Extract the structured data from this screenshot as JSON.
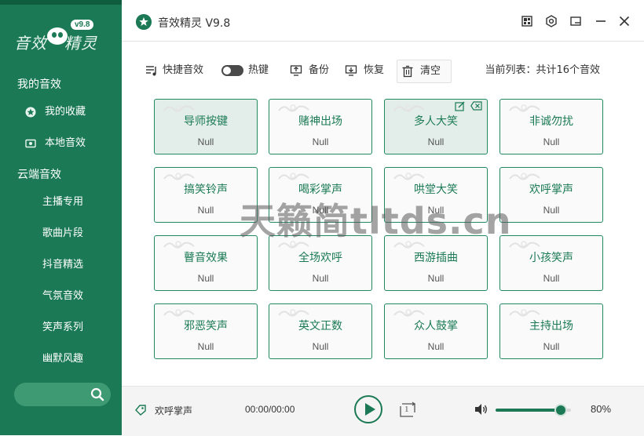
{
  "sidebar": {
    "logo": {
      "text_left": "音效",
      "text_right": "精灵",
      "version": "v9.8"
    },
    "my_sounds_label": "我的音效",
    "my_items": [
      {
        "label": "我的收藏",
        "icon": "star-badge-icon"
      },
      {
        "label": "本地音效",
        "icon": "local-folder-icon"
      }
    ],
    "cloud_label": "云端音效",
    "cloud_items": [
      "主播专用",
      "歌曲片段",
      "抖音精选",
      "气氛音效",
      "笑声系列",
      "幽默风趣"
    ],
    "search": {
      "placeholder": "",
      "icon": "search-icon"
    }
  },
  "titlebar": {
    "title": "音效精灵 V9.8",
    "buttons": [
      "skin-icon",
      "settings-icon",
      "minimize-window-icon",
      "minimize-icon",
      "close-icon"
    ]
  },
  "toolbar": {
    "quick_sound": "快捷音效",
    "hotkey": "热键",
    "backup": "备份",
    "restore": "恢复",
    "clear": "清空",
    "list_info": "当前列表：共计16个音效",
    "hotkey_enabled": false
  },
  "grid": {
    "cards": [
      {
        "name": "导师按键",
        "value": "Null",
        "highlighted": true
      },
      {
        "name": "赌神出场",
        "value": "Null",
        "highlighted": false
      },
      {
        "name": "多人大笑",
        "value": "Null",
        "highlighted": true,
        "show_actions": true
      },
      {
        "name": "非诚勿扰",
        "value": "Null",
        "highlighted": false
      },
      {
        "name": "搞笑铃声",
        "value": "Null",
        "highlighted": false
      },
      {
        "name": "喝彩掌声",
        "value": "Null",
        "highlighted": false
      },
      {
        "name": "哄堂大笑",
        "value": "Null",
        "highlighted": false
      },
      {
        "name": "欢呼掌声",
        "value": "Null",
        "highlighted": false
      },
      {
        "name": "瞽音效果",
        "value": "Null",
        "highlighted": false
      },
      {
        "name": "全场欢呼",
        "value": "Null",
        "highlighted": false
      },
      {
        "name": "西游插曲",
        "value": "Null",
        "highlighted": false
      },
      {
        "name": "小孩笑声",
        "value": "Null",
        "highlighted": false
      },
      {
        "name": "邪恶笑声",
        "value": "Null",
        "highlighted": false
      },
      {
        "name": "英文正数",
        "value": "Null",
        "highlighted": false
      },
      {
        "name": "众人鼓掌",
        "value": "Null",
        "highlighted": false
      },
      {
        "name": "主持出场",
        "value": "Null",
        "highlighted": false
      }
    ]
  },
  "watermark": "天籁简tltds.cn",
  "player": {
    "now_playing": "欢呼掌声",
    "time": "00:00/00:00",
    "loop_label": "1",
    "volume_label": "80%",
    "volume_fraction": 0.8
  },
  "colors": {
    "brand_green": "#1b7a55",
    "card_border": "#1f8a5f",
    "card_highlight": "#e3eeea"
  }
}
